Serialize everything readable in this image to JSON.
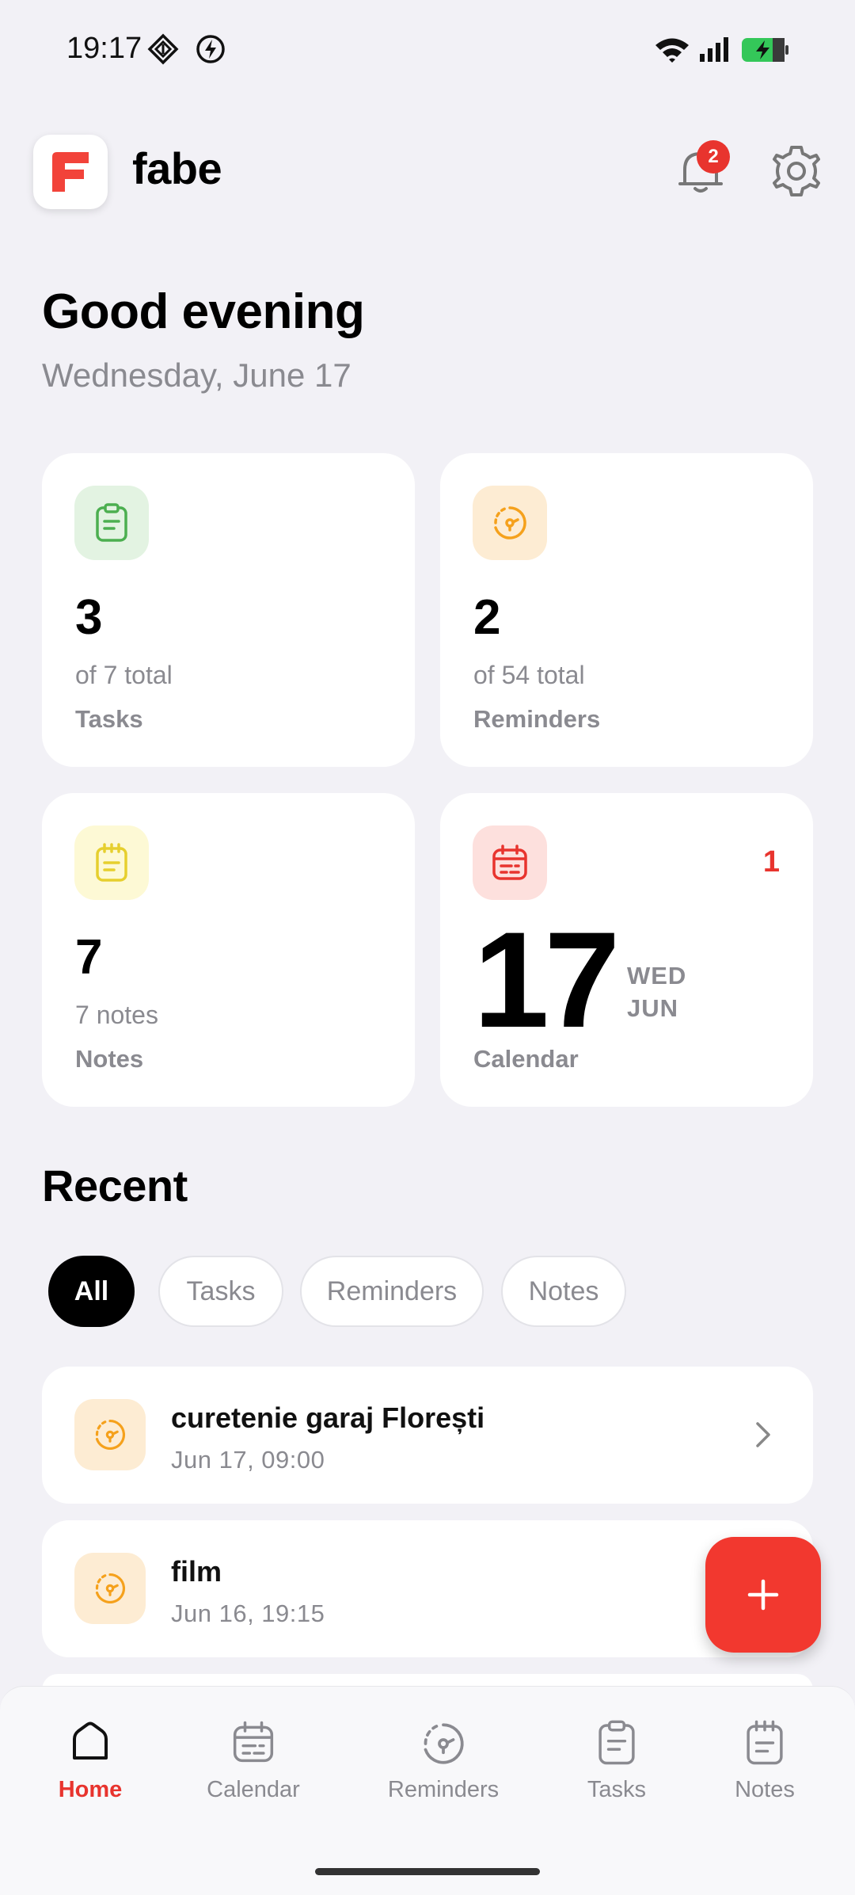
{
  "status_bar": {
    "time": "19:17",
    "icons": [
      "dnd-diamond-icon",
      "bolt-circle-icon",
      "wifi-icon",
      "signal-icon",
      "battery-charging-icon"
    ]
  },
  "header": {
    "app_name": "fabe",
    "logo_letter": "F",
    "notification_count": "2"
  },
  "greeting": {
    "title": "Good evening",
    "date": "Wednesday, June 17"
  },
  "cards": {
    "tasks": {
      "count": "3",
      "sub": "of 7 total",
      "label": "Tasks",
      "icon": "clipboard-icon",
      "color": "#4caf50"
    },
    "reminders": {
      "count": "2",
      "sub": "of 54 total",
      "label": "Reminders",
      "icon": "clock-dashed-icon",
      "color": "#f5a11c"
    },
    "notes": {
      "count": "7",
      "sub": "7 notes",
      "label": "Notes",
      "icon": "notepad-icon",
      "color": "#e6cf2e"
    },
    "calendar": {
      "day": "17",
      "weekday": "WED",
      "month": "JUN",
      "count": "1",
      "label": "Calendar",
      "icon": "calendar-icon",
      "color": "#e8342e"
    }
  },
  "recent": {
    "title": "Recent",
    "filters": [
      "All",
      "Tasks",
      "Reminders",
      "Notes"
    ],
    "active_filter": "All",
    "items": [
      {
        "title": "curetenie garaj Florești",
        "date": "Jun 17, 09:00",
        "icon": "clock-dashed-icon"
      },
      {
        "title": "film",
        "date": "Jun 16, 19:15",
        "icon": "clock-dashed-icon"
      }
    ]
  },
  "fab": {
    "icon": "plus-icon"
  },
  "nav": {
    "active": "Home",
    "items": [
      "Home",
      "Calendar",
      "Reminders",
      "Tasks",
      "Notes"
    ]
  },
  "colors": {
    "accent": "#e8342e",
    "background": "#f2f1f6",
    "card": "#ffffff"
  }
}
